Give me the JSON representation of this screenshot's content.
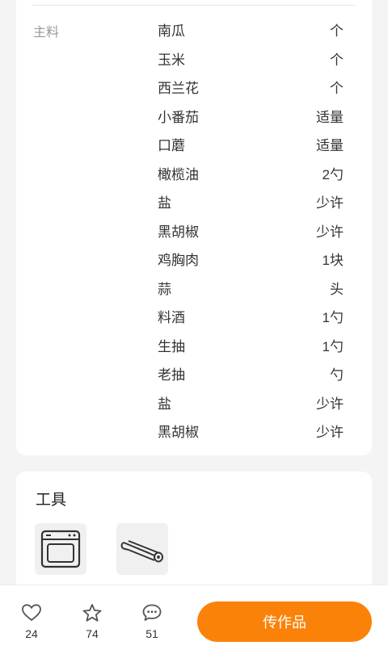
{
  "ingredients": {
    "section_label": "主料",
    "items": [
      {
        "name": "南瓜",
        "amount": "个"
      },
      {
        "name": "玉米",
        "amount": "个"
      },
      {
        "name": "西兰花",
        "amount": "个"
      },
      {
        "name": "小番茄",
        "amount": "适量"
      },
      {
        "name": "口蘑",
        "amount": "适量"
      },
      {
        "name": "橄榄油",
        "amount": "2勺"
      },
      {
        "name": "盐",
        "amount": "少许"
      },
      {
        "name": "黑胡椒",
        "amount": "少许"
      },
      {
        "name": "鸡胸肉",
        "amount": "1块"
      },
      {
        "name": "蒜",
        "amount": "头"
      },
      {
        "name": "料酒",
        "amount": "1勺"
      },
      {
        "name": "生抽",
        "amount": "1勺"
      },
      {
        "name": "老抽",
        "amount": "勺"
      },
      {
        "name": "盐",
        "amount": "少许"
      },
      {
        "name": "黑胡椒",
        "amount": "少许"
      }
    ]
  },
  "tools": {
    "title": "工具",
    "items": [
      {
        "icon": "oven-icon"
      },
      {
        "icon": "foil-roll-icon"
      }
    ]
  },
  "bottom_bar": {
    "like_count": "24",
    "favorite_count": "74",
    "comment_count": "51",
    "upload_label": "传作品",
    "accent_color": "#fb8208"
  }
}
